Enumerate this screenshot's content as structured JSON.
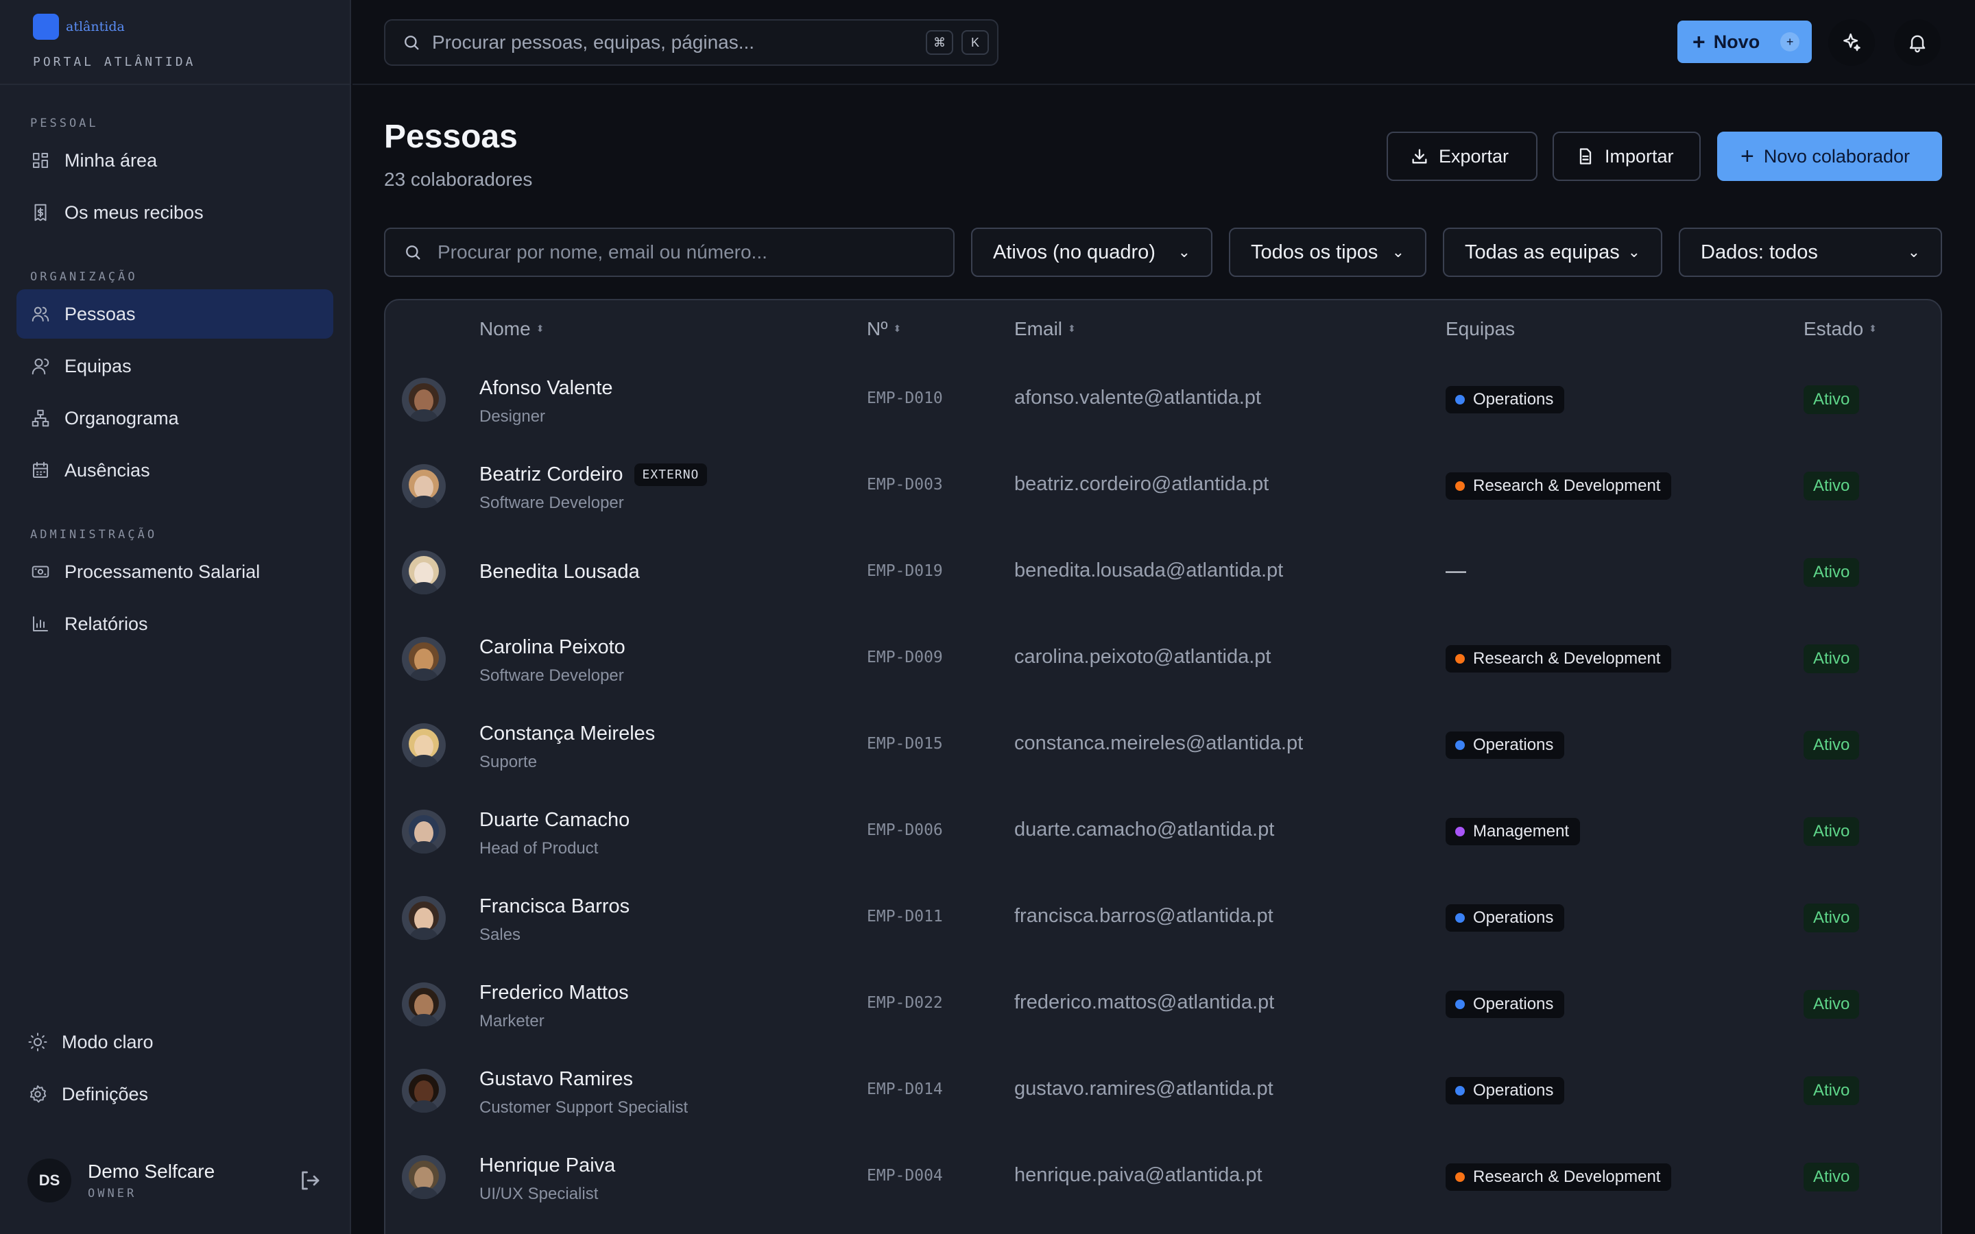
{
  "brand": {
    "name": "atlântida",
    "subtitle": "PORTAL ATLÂNTIDA"
  },
  "sidebar": {
    "sections": [
      {
        "heading": "PESSOAL",
        "items": [
          {
            "label": "Minha área",
            "icon": "dashboard-icon"
          },
          {
            "label": "Os meus recibos",
            "icon": "receipt-icon"
          }
        ]
      },
      {
        "heading": "ORGANIZAÇÃO",
        "items": [
          {
            "label": "Pessoas",
            "icon": "people-icon",
            "active": true
          },
          {
            "label": "Equipas",
            "icon": "team-icon"
          },
          {
            "label": "Organograma",
            "icon": "org-chart-icon"
          },
          {
            "label": "Ausências",
            "icon": "calendar-icon"
          }
        ]
      },
      {
        "heading": "ADMINISTRAÇÃO",
        "items": [
          {
            "label": "Processamento Salarial",
            "icon": "payroll-icon"
          },
          {
            "label": "Relatórios",
            "icon": "reports-icon"
          }
        ]
      }
    ],
    "bottom": [
      {
        "label": "Modo claro",
        "icon": "sun-icon"
      },
      {
        "label": "Definições",
        "icon": "gear-icon"
      }
    ],
    "user": {
      "initials": "DS",
      "name": "Demo Selfcare",
      "role": "OWNER"
    }
  },
  "topbar": {
    "search_placeholder": "Procurar pessoas, equipas, páginas...",
    "kbd1": "⌘",
    "kbd2": "K",
    "new_label": "Novo",
    "new_plus": "+"
  },
  "page": {
    "title": "Pessoas",
    "subtitle": "23 colaboradores",
    "export_label": "Exportar",
    "import_label": "Importar",
    "new_collab_label": "Novo colaborador"
  },
  "filters": {
    "search_placeholder": "Procurar por nome, email ou número...",
    "status": "Ativos (no quadro)",
    "type": "Todos os tipos",
    "team": "Todas as equipas",
    "data": "Dados: todos"
  },
  "table": {
    "headers": {
      "name": "Nome",
      "number": "Nº",
      "email": "Email",
      "teams": "Equipas",
      "status": "Estado"
    },
    "rows": [
      {
        "name": "Afonso Valente",
        "role": "Designer",
        "number": "EMP-D010",
        "email": "afonso.valente@atlantida.pt",
        "team": "Operations",
        "team_color": "#3b82f6",
        "status": "Ativo",
        "avatar_color": "#9a6a4e",
        "hair_color": "#3d2a1f"
      },
      {
        "name": "Beatriz Cordeiro",
        "tag": "EXTERNO",
        "role": "Software Developer",
        "number": "EMP-D003",
        "email": "beatriz.cordeiro@atlantida.pt",
        "team": "Research & Development",
        "team_color": "#f97316",
        "status": "Ativo",
        "avatar_color": "#e2c4ac",
        "hair_color": "#c99a6a"
      },
      {
        "name": "Benedita Lousada",
        "role": "",
        "number": "EMP-D019",
        "email": "benedita.lousada@atlantida.pt",
        "team": "",
        "team_empty": "—",
        "status": "Ativo",
        "avatar_color": "#f0e2d4",
        "hair_color": "#dcc8a4"
      },
      {
        "name": "Carolina Peixoto",
        "role": "Software Developer",
        "number": "EMP-D009",
        "email": "carolina.peixoto@atlantida.pt",
        "team": "Research & Development",
        "team_color": "#f97316",
        "status": "Ativo",
        "avatar_color": "#c7925e",
        "hair_color": "#6e4a2b"
      },
      {
        "name": "Constança Meireles",
        "role": "Suporte",
        "number": "EMP-D015",
        "email": "constanca.meireles@atlantida.pt",
        "team": "Operations",
        "team_color": "#3b82f6",
        "status": "Ativo",
        "avatar_color": "#edd0ab",
        "hair_color": "#e0c07a"
      },
      {
        "name": "Duarte Camacho",
        "role": "Head of Product",
        "number": "EMP-D006",
        "email": "duarte.camacho@atlantida.pt",
        "team": "Management",
        "team_color": "#a855f7",
        "status": "Ativo",
        "avatar_color": "#d8b8a0",
        "hair_color": "#2b3a55"
      },
      {
        "name": "Francisca Barros",
        "role": "Sales",
        "number": "EMP-D011",
        "email": "francisca.barros@atlantida.pt",
        "team": "Operations",
        "team_color": "#3b82f6",
        "status": "Ativo",
        "avatar_color": "#e2c0a4",
        "hair_color": "#3a2a22"
      },
      {
        "name": "Frederico Mattos",
        "role": "Marketer",
        "number": "EMP-D022",
        "email": "frederico.mattos@atlantida.pt",
        "team": "Operations",
        "team_color": "#3b82f6",
        "status": "Ativo",
        "avatar_color": "#a87a58",
        "hair_color": "#2a1e16"
      },
      {
        "name": "Gustavo Ramires",
        "role": "Customer Support Specialist",
        "number": "EMP-D014",
        "email": "gustavo.ramires@atlantida.pt",
        "team": "Operations",
        "team_color": "#3b82f6",
        "status": "Ativo",
        "avatar_color": "#5a3422",
        "hair_color": "#1e140e"
      },
      {
        "name": "Henrique Paiva",
        "role": "UI/UX Specialist",
        "number": "EMP-D004",
        "email": "henrique.paiva@atlantida.pt",
        "team": "Research & Development",
        "team_color": "#f97316",
        "status": "Ativo",
        "avatar_color": "#b08d6d",
        "hair_color": "#5a4a36"
      }
    ]
  }
}
